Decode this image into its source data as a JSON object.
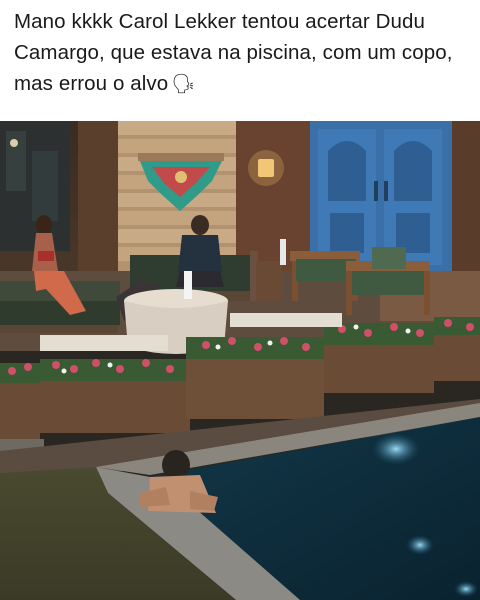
{
  "post": {
    "caption_text": "Mano kkkk Carol Lekker tentou acertar Dudu Camargo, que estava na piscina, com um copo, mas errou o alvo",
    "caption_emoji": "🗣"
  },
  "media": {
    "kind": "video-frame",
    "description_icon": "photo-frame-icon"
  },
  "colors": {
    "caption": "#1a1a1a",
    "door": "#3a6fa8",
    "pool": "#0e2a3a",
    "deck": "#6b5a4a"
  }
}
